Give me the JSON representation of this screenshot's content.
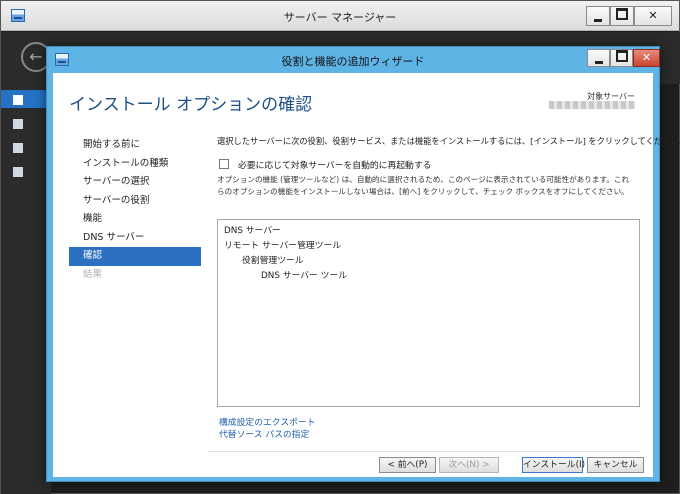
{
  "server_manager": {
    "title": "サーバー マネージャー"
  },
  "wizard": {
    "title": "役割と機能の追加ウィザード",
    "heading": "インストール オプションの確認",
    "target_label": "対象サーバー",
    "steps": [
      {
        "label": "開始する前に",
        "state": "normal"
      },
      {
        "label": "インストールの種類",
        "state": "normal"
      },
      {
        "label": "サーバーの選択",
        "state": "normal"
      },
      {
        "label": "サーバーの役割",
        "state": "normal"
      },
      {
        "label": "機能",
        "state": "normal"
      },
      {
        "label": "DNS サーバー",
        "state": "normal"
      },
      {
        "label": "確認",
        "state": "active"
      },
      {
        "label": "結果",
        "state": "disabled"
      }
    ],
    "intro": "選択したサーバーに次の役割、役割サービス、または機能をインストールするには、[インストール] をクリックしてください。",
    "restart_label": "必要に応じて対象サーバーを自動的に再起動する",
    "restart_checked": false,
    "note_line1": "オプションの機能 (管理ツールなど) は、自動的に選択されるため、このページに表示されている可能性があります。これ",
    "note_line2": "らのオプションの機能をインストールしない場合は、[前へ] をクリックして、チェック ボックスをオフにしてください。",
    "summary": [
      {
        "text": "DNS サーバー",
        "level": 0
      },
      {
        "text": "リモート サーバー管理ツール",
        "level": 0
      },
      {
        "text": "役割管理ツール",
        "level": 1
      },
      {
        "text": "DNS サーバー ツール",
        "level": 2
      }
    ],
    "links": {
      "export": "構成設定のエクスポート",
      "alt_source": "代替ソース パスの指定"
    },
    "buttons": {
      "prev": "< 前へ(P)",
      "next": "次へ(N) >",
      "install": "インストール(I)",
      "cancel": "キャンセル"
    }
  },
  "icons": {
    "minimize": "minimize-icon",
    "maximize": "maximize-icon",
    "close": "close-icon",
    "back": "back-arrow-icon",
    "app": "server-manager-icon"
  },
  "colors": {
    "wizard_frame": "#5fb4e6",
    "active_step": "#2c70c1",
    "heading": "#1d4f86",
    "link": "#1f5fb0",
    "close_button": "#c9452f"
  }
}
